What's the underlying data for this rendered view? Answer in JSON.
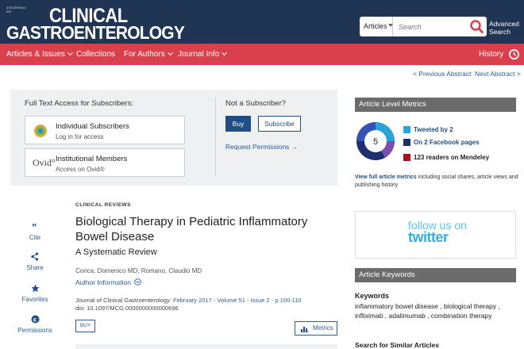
{
  "header": {
    "logo_small": "JOURNAL OF",
    "logo_big_1": "CLINICAL",
    "logo_big_2": "GASTROENTEROLOGY",
    "search_scope": "Articles",
    "search_placeholder": "Search",
    "advanced_search_line1": "Advanced",
    "advanced_search_line2": "Search"
  },
  "nav": {
    "items": [
      {
        "label": "Articles & Issues",
        "has_dropdown": true
      },
      {
        "label": "Collections",
        "has_dropdown": false
      },
      {
        "label": "For Authors",
        "has_dropdown": true
      },
      {
        "label": "Journal Info",
        "has_dropdown": true
      }
    ],
    "history_label": "History"
  },
  "pager": {
    "prev": "< Previous Abstract",
    "next": "Next Abstract >"
  },
  "access": {
    "title": "Full Text Access for Subscribers:",
    "individual_title": "Individual Subscribers",
    "individual_sub": "Log in for access",
    "institutional_title": "Institutional Members",
    "institutional_sub": "Access on Ovid®",
    "ovid_logo_text": "Ovid°",
    "not_subscriber": "Not a Subscriber?",
    "buy_label": "Buy",
    "subscribe_label": "Subscribe",
    "request_permissions": "Request Permissions →"
  },
  "tools": {
    "cite": "Cite",
    "share": "Share",
    "favorites": "Favorites",
    "permissions": "Permissions"
  },
  "article": {
    "section": "CLINICAL REVIEWS",
    "title": "Biological Therapy in Pediatric Inflammatory Bowel Disease",
    "subtitle": "A Systematic Review",
    "authors": "Corica, Domenico MD; Romano, Claudio MD",
    "author_info": "Author Information",
    "citation_prefix": "Journal of Clinical Gastroenterology: ",
    "citation_link": "February 2017 - Volume 51 - Issue 2 - p 100-110",
    "doi": "doi: 10.1097/MCG.0000000000000696",
    "buy_small": "BUY",
    "metrics_label": "Metrics"
  },
  "metrics_panel": {
    "title": "Article Level Metrics",
    "score": "5",
    "tweeted": "Tweeted by 2",
    "facebook": "On 2 Facebook pages",
    "mendeley": "123 readers on Mendeley",
    "view_full_link": "View full article metrics",
    "view_full_rest": " including social shares, article views and publishing history",
    "colors": {
      "twitter": "#2aa3d8",
      "facebook": "#1e2e6e",
      "mendeley": "#a8101c"
    }
  },
  "twitter_box": {
    "line1": "follow us on",
    "line2": "twitter"
  },
  "keywords_panel": {
    "title": "Article Keywords",
    "keywords_heading": "Keywords",
    "keywords": "inflammatory bowel disease , biological therapy , infliximab , adalimumab , combination therapy",
    "similar_heading": "Search for Similar Articles"
  }
}
